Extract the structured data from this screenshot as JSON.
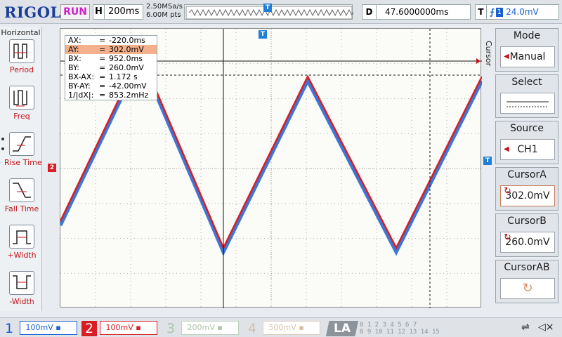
{
  "header": {
    "brand": "RIGOL",
    "run_status": "RUN",
    "horizontal": {
      "key": "H",
      "value": "200ms"
    },
    "sample_rate": "2.50MSa/s",
    "memory_depth": "6.00M pts",
    "delay": {
      "key": "D",
      "value": "47.6000000ms"
    },
    "trigger": {
      "key": "T",
      "edge": "rising-edge-icon",
      "source": "1",
      "level": "24.0mV"
    },
    "trigger_marker": "T"
  },
  "left_panel": {
    "title": "Horizontal",
    "items": [
      {
        "label": "Period",
        "icon": "period-icon"
      },
      {
        "label": "Freq",
        "icon": "freq-icon"
      },
      {
        "label": "Rise Time",
        "icon": "rise-time-icon"
      },
      {
        "label": "Fall Time",
        "icon": "fall-time-icon"
      },
      {
        "label": "+Width",
        "icon": "positive-width-icon"
      },
      {
        "label": "-Width",
        "icon": "negative-width-icon"
      }
    ]
  },
  "cursor_table": [
    {
      "name": "AX:",
      "value": "-220.0ms"
    },
    {
      "name": "AY:",
      "value": "302.0mV"
    },
    {
      "name": "BX:",
      "value": "952.0ms"
    },
    {
      "name": "BY:",
      "value": "260.0mV"
    },
    {
      "name": "BX-AX:",
      "value": "1.172 s"
    },
    {
      "name": "BY-AY:",
      "value": "-42.00mV"
    },
    {
      "name": "1/|dX|:",
      "value": "853.2mHz"
    }
  ],
  "markers": {
    "ch2": "2",
    "trig_level_side": "T"
  },
  "right_menu": {
    "vertical_title": "Cursor",
    "items": [
      {
        "title": "Mode",
        "value": "Manual"
      },
      {
        "title": "Select",
        "value": ""
      },
      {
        "title": "Source",
        "value": "CH1"
      },
      {
        "title": "CursorA",
        "value": "302.0mV"
      },
      {
        "title": "CursorB",
        "value": "260.0mV"
      },
      {
        "title": "CursorAB",
        "value": ""
      }
    ]
  },
  "bottom": {
    "channels": [
      {
        "num": "1",
        "scale": "100mV"
      },
      {
        "num": "2",
        "scale": "100mV"
      },
      {
        "num": "3",
        "scale": "200mV"
      },
      {
        "num": "4",
        "scale": "500mV"
      }
    ],
    "la": "LA",
    "la_bits_top": "0 1 2 3   4 5 6 7",
    "la_bits_bottom": "8 9 10 11  12 13 14 15"
  },
  "colors": {
    "ch1": "#1a5fd0",
    "ch2": "#d81e24",
    "accent": "#c0141a"
  }
}
